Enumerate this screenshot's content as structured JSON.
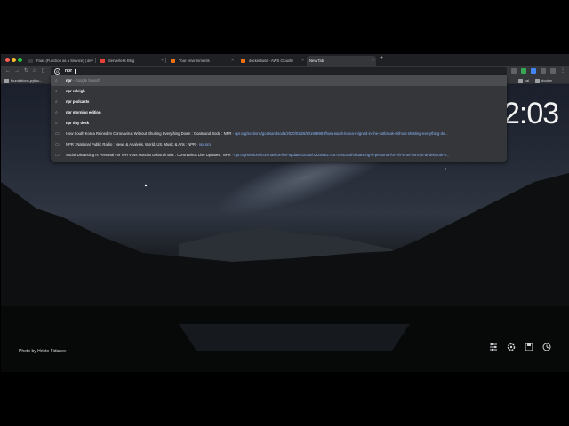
{
  "window": {
    "traffic_colors": [
      "#ff5f57",
      "#febc2e",
      "#28c840"
    ]
  },
  "tabs": [
    {
      "label": "Faas (Function as a Service) | dev",
      "fav_color": "#3c3c3c",
      "active": false
    },
    {
      "label": "Serverless Blog",
      "fav_color": "#e94235",
      "active": false
    },
    {
      "label": "Your environments",
      "fav_color": "#ec7211",
      "active": false
    },
    {
      "label": "dockerbuild - AWS Cloud9",
      "fav_color": "#ec7211",
      "active": false
    },
    {
      "label": "New Tab",
      "fav_color": "#5f6368",
      "active": true
    }
  ],
  "toolbar": {
    "omnibox_text": "npr",
    "extension_colors": [
      "#5f6368",
      "#34a853",
      "#4285f4",
      "#5f6368",
      "#5f6368"
    ]
  },
  "bookmarks": {
    "left": "foundations-pytho...",
    "right": [
      "cal",
      "docker"
    ]
  },
  "suggestions": [
    {
      "query": "npr",
      "suffix": " - Google Search",
      "url": "",
      "type": "search",
      "selected": true
    },
    {
      "query": "npr raleigh",
      "suffix": "",
      "url": "",
      "type": "search",
      "selected": false
    },
    {
      "query": "npr podcasts",
      "suffix": "",
      "url": "",
      "type": "search",
      "selected": false
    },
    {
      "query": "npr morning edition",
      "suffix": "",
      "url": "",
      "type": "search",
      "selected": false
    },
    {
      "query": "npr tiny desk",
      "suffix": "",
      "url": "",
      "type": "search",
      "selected": false
    },
    {
      "query": "How South Korea Reined In Coronavirus Without Shutting Everything Down : Goats and Soda : NPR",
      "suffix": " - ",
      "url": "npr.org/sections/goatsandsoda/2020/03/26/821688981/how-south-korea-reigned-in-the-outbreak-without-shutting-everything-do...",
      "type": "history",
      "selected": false
    },
    {
      "query": "NPR : National Public Radio : News & Analysis, World, US, Music & Arts : NPR",
      "suffix": " - ",
      "url": "npr.org",
      "type": "history",
      "selected": false
    },
    {
      "query": "Social Distancing Is Personal For WH Virus Honcho Deborah Birx : Coronavirus Live Updates : NPR",
      "suffix": " - ",
      "url": "npr.org/sections/coronavirus-live-updates/2020/03/25/821708744/social-distancing-is-personal-for-wh-virus-honcho-dr-deborah-b...",
      "type": "history",
      "selected": false
    }
  ],
  "page": {
    "clock": "2:03",
    "photo_credit": "Photo by Hristo Fidanov"
  }
}
